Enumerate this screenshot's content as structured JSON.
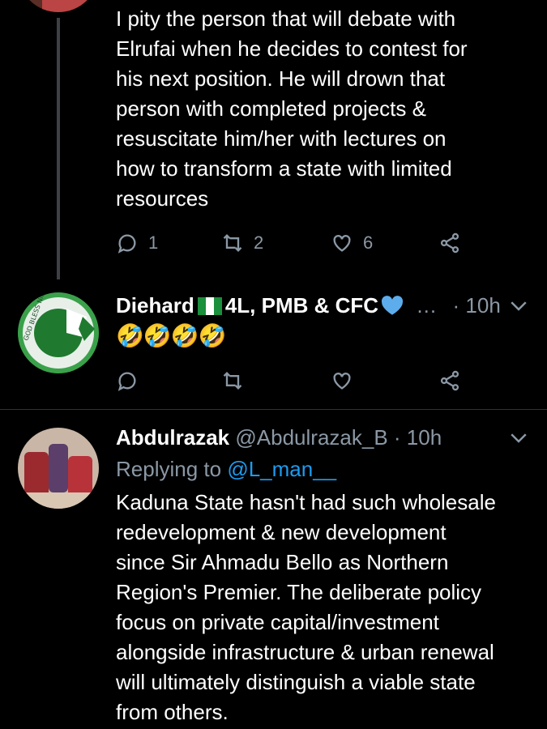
{
  "tweet1": {
    "text_lines": [
      "I pity the person that will debate with",
      "Elrufai when he decides to contest for",
      "his next position. He will drown that",
      "person with completed projects &",
      "resuscitate him/her with lectures on",
      "how to transform a state with limited",
      "resources"
    ],
    "reply_count": "1",
    "retweet_count": "2",
    "like_count": "6"
  },
  "tweet2": {
    "name_prefix": "Diehard",
    "name_suffix": "4L, PMB & CFC",
    "ellipsis": "…",
    "time": "· 10h",
    "avatar_text": "GOD BLESS NIGERIA",
    "emoji_text": "🤣🤣🤣🤣"
  },
  "tweet3": {
    "name": "Abdulrazak",
    "handle": "@Abdulrazak_B",
    "time": "· 10h",
    "replying_to_label": "Replying to",
    "replying_to_handle": "@L_man__",
    "text_lines": [
      "Kaduna State hasn't had such wholesale",
      "redevelopment & new development",
      "since Sir Ahmadu Bello as Northern",
      "Region's Premier. The deliberate policy",
      "focus on private capital/investment",
      "alongside infrastructure & urban renewal",
      "will ultimately distinguish a viable state",
      "from others."
    ]
  },
  "colors": {
    "background": "#000000",
    "muted": "#8b98a5",
    "link": "#1d9bf0",
    "divider": "#2f3336"
  }
}
